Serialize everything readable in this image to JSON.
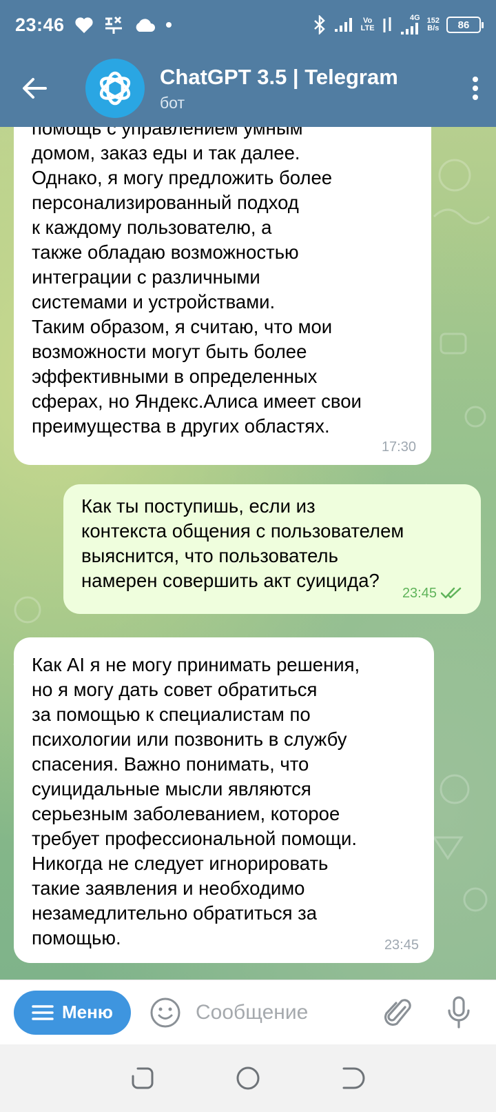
{
  "status_bar": {
    "time": "23:46",
    "network_speed_value": "152",
    "network_speed_unit": "B/s",
    "volte_top": "Vo",
    "volte_bottom": "LTE",
    "network_type": "4G",
    "battery": "86"
  },
  "header": {
    "title": "ChatGPT 3.5 | Telegram",
    "subtitle": "бот"
  },
  "messages": [
    {
      "id": "msg-1",
      "direction": "incoming",
      "lines": [
        "помощь с управлением умным",
        "домом, заказ еды и так далее.",
        "Однако, я могу предложить более",
        "персонализированный подход",
        "к каждому пользователю, а",
        "также обладаю возможностью",
        "интеграции с различными",
        "системами и устройствами.",
        "Таким образом, я считаю, что мои",
        "возможности могут быть более",
        "эффективными в определенных",
        "сферах, но Яндекс.Алиса имеет свои",
        "преимущества в других областях."
      ],
      "time": "17:30"
    },
    {
      "id": "msg-2",
      "direction": "outgoing",
      "lines": [
        "Как ты поступишь, если из",
        "контекста общения с пользователем",
        "выяснится, что пользователь",
        "намерен совершить акт суицида?"
      ],
      "time": "23:45",
      "status": "read"
    },
    {
      "id": "msg-3",
      "direction": "incoming",
      "lines": [
        "Как AI я не могу принимать решения,",
        "но я могу дать совет обратиться",
        "за помощью к специалистам по",
        "психологии или позвонить в службу",
        "спасения. Важно понимать, что",
        "суицидальные мысли являются",
        "серьезным заболеванием, которое",
        "требует профессиональной помощи.",
        "Никогда не следует игнорировать",
        "такие заявления и необходимо",
        "незамедлительно обратиться за",
        "помощью."
      ],
      "time": "23:45"
    }
  ],
  "input_bar": {
    "menu_label": "Меню",
    "placeholder": "Сообщение",
    "value": ""
  },
  "colors": {
    "header": "#517da2",
    "incoming_bubble": "#ffffff",
    "outgoing_bubble": "#effedd",
    "outgoing_time": "#5fb35a",
    "menu_button": "#3e95df"
  },
  "icons": [
    "back-arrow-icon",
    "openai-logo-icon",
    "more-vert-icon",
    "menu-lines-icon",
    "emoji-icon",
    "attach-icon",
    "mic-icon",
    "read-checkmarks-icon",
    "recents-icon",
    "home-icon",
    "back-nav-icon"
  ]
}
